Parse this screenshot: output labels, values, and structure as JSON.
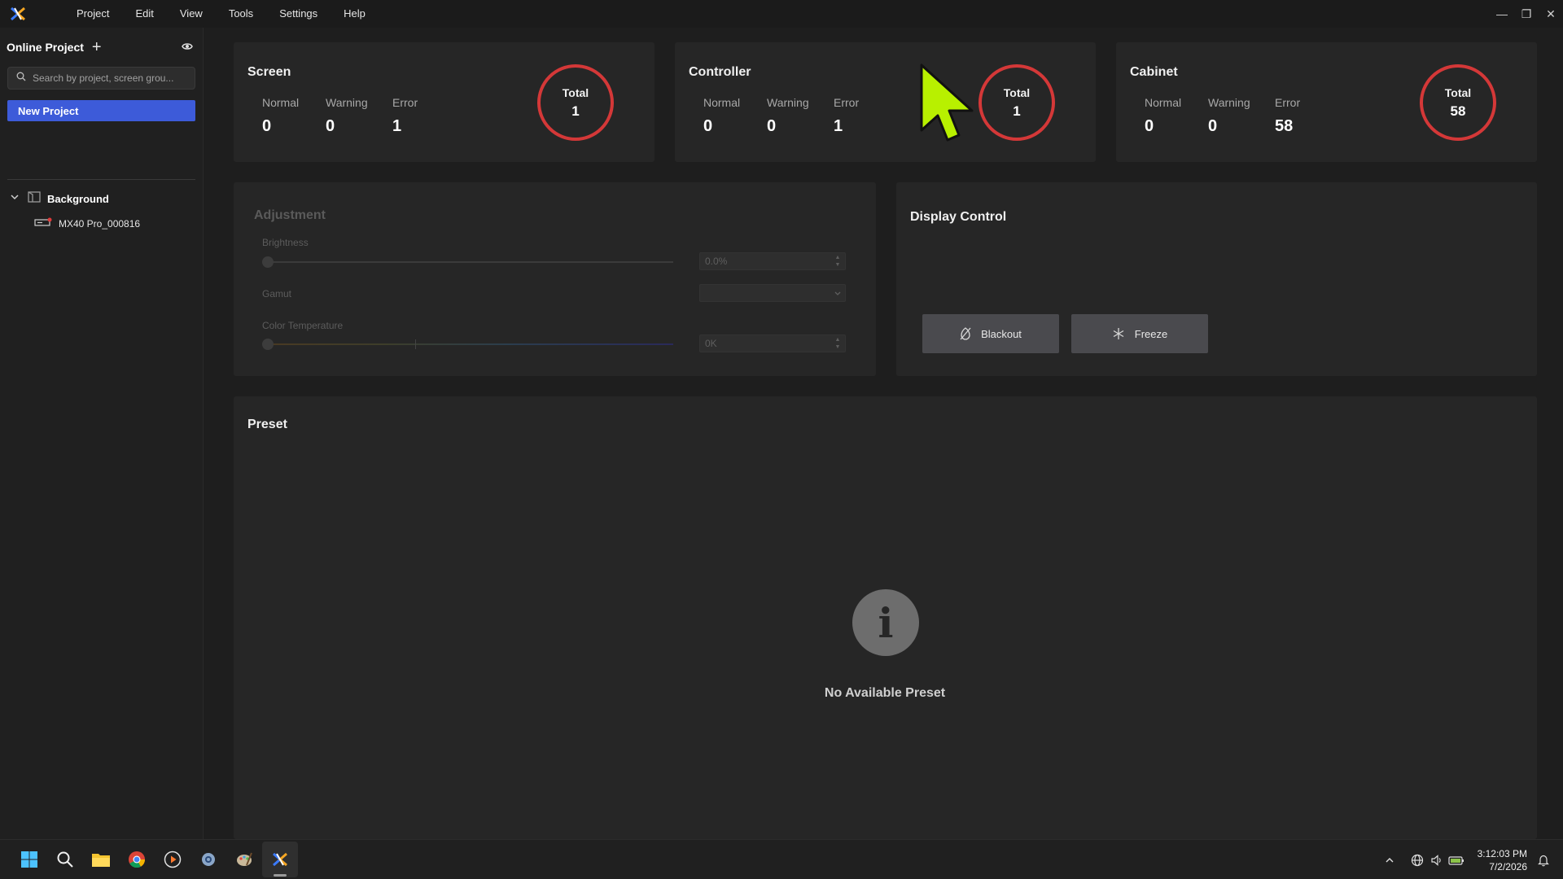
{
  "menu": {
    "items": [
      "Project",
      "Edit",
      "View",
      "Tools",
      "Settings",
      "Help"
    ]
  },
  "window_controls": {
    "minimize": "—",
    "restore": "❐",
    "close": "✕"
  },
  "sidebar": {
    "title": "Online Project",
    "add_icon": "+",
    "search_placeholder": "Search by project, screen grou...",
    "new_project_label": "New Project",
    "tree": {
      "group_label": "Background",
      "item_label": "MX40 Pro_000816"
    }
  },
  "status": {
    "screen": {
      "title": "Screen",
      "normal_label": "Normal",
      "warning_label": "Warning",
      "error_label": "Error",
      "normal": "0",
      "warning": "0",
      "error": "1",
      "total_label": "Total",
      "total": "1"
    },
    "controller": {
      "title": "Controller",
      "normal_label": "Normal",
      "warning_label": "Warning",
      "error_label": "Error",
      "normal": "0",
      "warning": "0",
      "error": "1",
      "total_label": "Total",
      "total": "1"
    },
    "cabinet": {
      "title": "Cabinet",
      "normal_label": "Normal",
      "warning_label": "Warning",
      "error_label": "Error",
      "normal": "0",
      "warning": "0",
      "error": "58",
      "total_label": "Total",
      "total": "58"
    }
  },
  "adjustment": {
    "title": "Adjustment",
    "brightness_label": "Brightness",
    "brightness_value": "0.0%",
    "gamut_label": "Gamut",
    "gamut_value": "",
    "color_temp_label": "Color Temperature",
    "color_temp_value": "0K"
  },
  "display_control": {
    "title": "Display Control",
    "blackout_label": "Blackout",
    "freeze_label": "Freeze"
  },
  "preset": {
    "title": "Preset",
    "empty_icon": "i",
    "empty_text": "No Available Preset"
  },
  "colors": {
    "accent": "#3d5bd9",
    "error_ring": "#d43838",
    "cursor": "#b8f000"
  },
  "taskbar": {
    "icons": [
      "windows-start-icon",
      "search-icon",
      "file-explorer-icon",
      "chrome-icon",
      "media-player-icon",
      "settings-gear-icon",
      "paint-app-icon",
      "novastar-app-icon"
    ],
    "time": "3:12:03 PM",
    "date": "7/2/2026"
  }
}
